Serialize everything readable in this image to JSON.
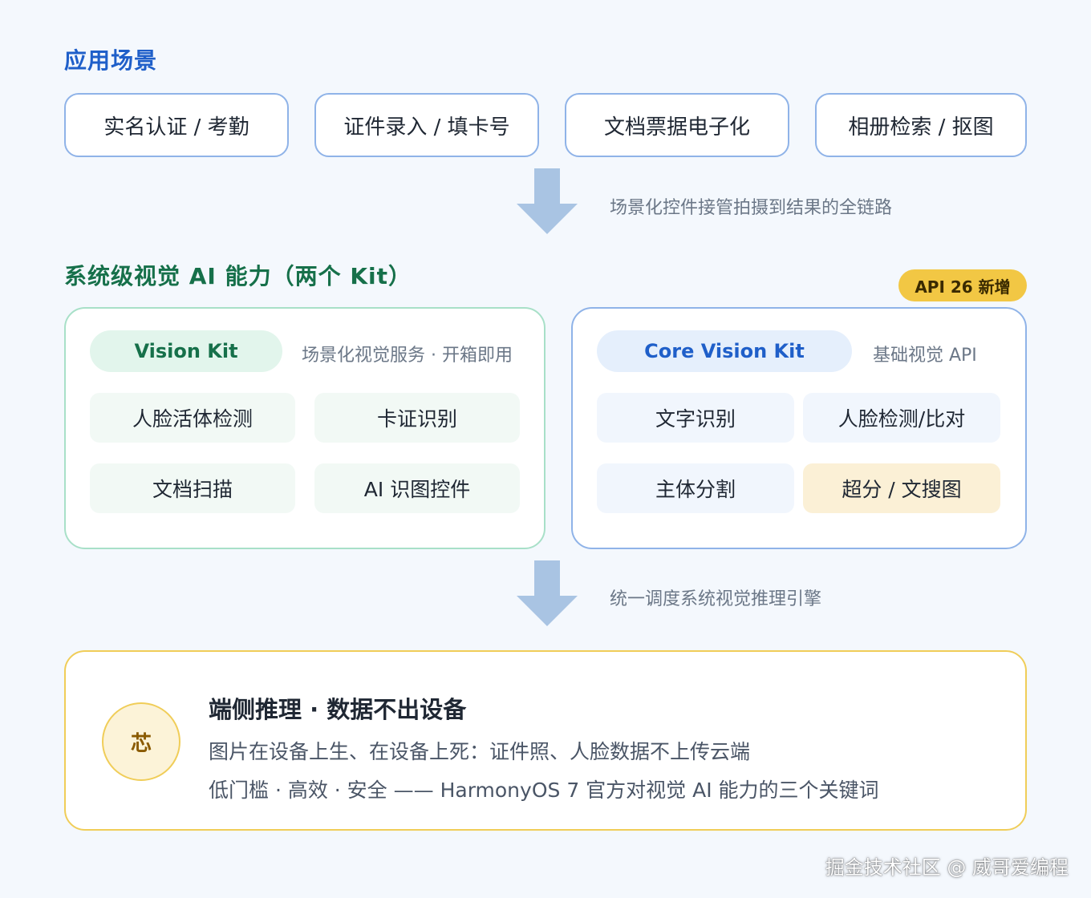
{
  "scenarios": {
    "title": "应用场景",
    "items": [
      "实名认证 / 考勤",
      "证件录入 / 填卡号",
      "文档票据电子化",
      "相册检索 / 抠图"
    ]
  },
  "flow": {
    "note_1": "场景化控件接管拍摄到结果的全链路",
    "note_2": "统一调度系统视觉推理引擎"
  },
  "capabilities": {
    "title": "系统级视觉 AI 能力（两个 Kit）",
    "badge": "API 26 新增",
    "vision_kit": {
      "name": "Vision Kit",
      "description": "场景化视觉服务 · 开箱即用",
      "items": [
        "人脸活体检测",
        "卡证识别",
        "文档扫描",
        "AI 识图控件"
      ]
    },
    "core_vision_kit": {
      "name": "Core Vision Kit",
      "description": "基础视觉 API",
      "items": [
        "文字识别",
        "人脸检测/比对",
        "主体分割",
        "超分 / 文搜图"
      ]
    }
  },
  "engine": {
    "chip_label": "芯",
    "title": "端侧推理 · 数据不出设备",
    "line_1": "图片在设备上生、在设备上死：证件照、人脸数据不上传云端",
    "line_2": "低门槛 · 高效 · 安全 —— HarmonyOS 7 官方对视觉 AI 能力的三个关键词"
  },
  "watermark": "掘金技术社区 @ 威哥爱编程",
  "colors": {
    "background": "#f4f8fd",
    "blue_accent": "#1f5fc9",
    "green_accent": "#16704a",
    "yellow_accent": "#f0cd58",
    "arrow": "#a9c4e3"
  }
}
